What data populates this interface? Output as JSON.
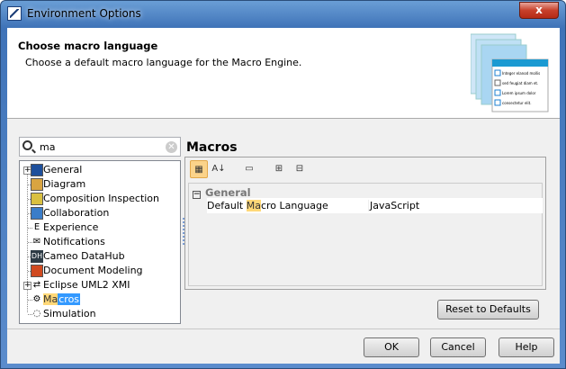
{
  "window": {
    "title": "Environment Options",
    "close_label": "x"
  },
  "header": {
    "title": "Choose macro language",
    "description": "Choose a default macro language for the Macro Engine.",
    "art_items": [
      "Integer elanod mollis",
      "sed feugiat diam et.",
      "Lorem ipsum dolor",
      "consectetur elit."
    ]
  },
  "search": {
    "value": "ma"
  },
  "tree": {
    "items": [
      {
        "label": "General",
        "icon": "general-icon",
        "expandable": true
      },
      {
        "label": "Diagram",
        "icon": "diagram-icon"
      },
      {
        "label": "Composition Inspection",
        "icon": "composition-icon"
      },
      {
        "label": "Collaboration",
        "icon": "collaboration-icon"
      },
      {
        "label": "Experience",
        "icon": "experience-icon",
        "glyph": "E"
      },
      {
        "label": "Notifications",
        "icon": "envelope-icon",
        "glyph": "✉"
      },
      {
        "label": "Cameo DataHub",
        "icon": "datahub-icon",
        "glyph": "DH"
      },
      {
        "label": "Document Modeling",
        "icon": "document-icon"
      },
      {
        "label": "Eclipse UML2 XMI",
        "icon": "arrows-icon",
        "glyph": "⇄",
        "expandable": true
      },
      {
        "label": "Macros",
        "icon": "gears-icon",
        "glyph": "⚙",
        "selected": true,
        "match": "Ma",
        "rest": "cros"
      },
      {
        "label": "Simulation",
        "icon": "simulation-icon",
        "glyph": "◌"
      }
    ]
  },
  "main": {
    "title": "Macros",
    "toolbar": [
      "categorized-view",
      "sort-alphabetical",
      "description",
      "expand-all",
      "collapse-all"
    ],
    "group": "General",
    "property": {
      "key_pre": "Default ",
      "key_match": "Ma",
      "key_post": "cro Language",
      "value": "JavaScript"
    }
  },
  "buttons": {
    "reset": "Reset to Defaults",
    "ok": "OK",
    "cancel": "Cancel",
    "help": "Help"
  }
}
